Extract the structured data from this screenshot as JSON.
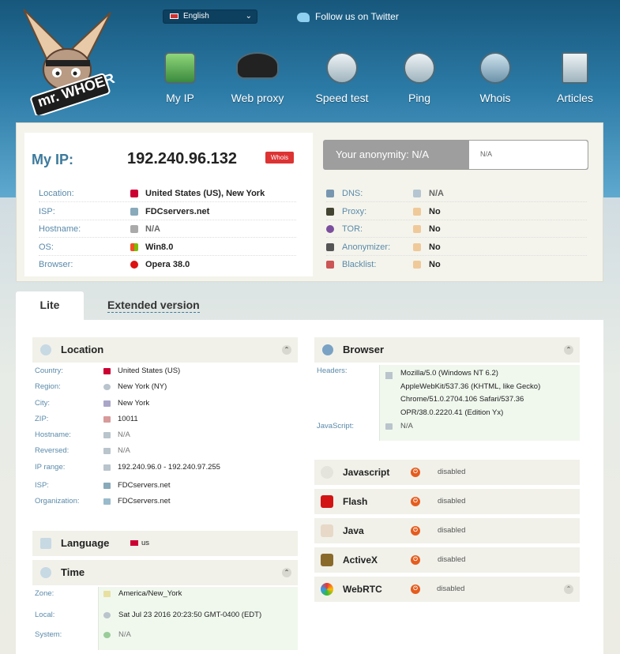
{
  "brand": {
    "logo_text": "mr. WHOER"
  },
  "header": {
    "language": "English",
    "twitter": "Follow us on Twitter",
    "nav": [
      {
        "label": "My IP",
        "icon": "home-icon"
      },
      {
        "label": "Web proxy",
        "icon": "spy-hat-icon"
      },
      {
        "label": "Speed test",
        "icon": "speedometer-icon"
      },
      {
        "label": "Ping",
        "icon": "ping-icon"
      },
      {
        "label": "Whois",
        "icon": "question-icon"
      },
      {
        "label": "Articles",
        "icon": "document-icon"
      }
    ]
  },
  "ip": {
    "label": "My IP:",
    "value": "192.240.96.132",
    "whois": "Whois",
    "rows": [
      {
        "key": "Location:",
        "value": "United States (US), New York",
        "icon": "us-flag-icon"
      },
      {
        "key": "ISP:",
        "value": "FDCservers.net",
        "icon": "isp-icon"
      },
      {
        "key": "Hostname:",
        "value": "N/A",
        "icon": "hostname-icon"
      },
      {
        "key": "OS:",
        "value": "Win8.0",
        "icon": "windows-icon"
      },
      {
        "key": "Browser:",
        "value": "Opera 38.0",
        "icon": "opera-icon"
      }
    ]
  },
  "anonymity": {
    "label": "Your anonymity: N/A",
    "value": "N/A",
    "rows": [
      {
        "key": "DNS:",
        "value": "N/A",
        "icon": "dns-icon"
      },
      {
        "key": "Proxy:",
        "value": "No",
        "icon": "thumbs-up-icon"
      },
      {
        "key": "TOR:",
        "value": "No",
        "icon": "thumbs-up-icon"
      },
      {
        "key": "Anonymizer:",
        "value": "No",
        "icon": "thumbs-up-icon"
      },
      {
        "key": "Blacklist:",
        "value": "No",
        "icon": "thumbs-up-icon"
      }
    ]
  },
  "tabs": {
    "lite": "Lite",
    "extended": "Extended version"
  },
  "location": {
    "title": "Location",
    "rows": [
      {
        "key": "Country:",
        "value": "United States (US)"
      },
      {
        "key": "Region:",
        "value": "New York (NY)"
      },
      {
        "key": "City:",
        "value": "New York"
      },
      {
        "key": "ZIP:",
        "value": "10011"
      },
      {
        "key": "Hostname:",
        "value": "N/A"
      },
      {
        "key": "Reversed:",
        "value": "N/A"
      },
      {
        "key": "IP range:",
        "value": "192.240.96.0 - 192.240.97.255"
      },
      {
        "key": "ISP:",
        "value": "FDCservers.net"
      },
      {
        "key": "Organization:",
        "value": "FDCservers.net"
      }
    ]
  },
  "language": {
    "title": "Language",
    "value": "us"
  },
  "time": {
    "title": "Time",
    "rows": [
      {
        "key": "Zone:",
        "value": "America/New_York"
      },
      {
        "key": "Local:",
        "value": "Sat Jul 23 2016 20:23:50 GMT-0400 (EDT)"
      },
      {
        "key": "System:",
        "value": "N/A"
      }
    ]
  },
  "browser": {
    "title": "Browser",
    "headers_key": "Headers:",
    "headers_lines": [
      "Mozilla/5.0 (Windows NT 6.2)",
      "AppleWebKit/537.36 (KHTML, like Gecko)",
      "Chrome/51.0.2704.106 Safari/537.36",
      "OPR/38.0.2220.41 (Edition Yx)"
    ],
    "js_key": "JavaScript:",
    "js_value": "N/A"
  },
  "plugins": [
    {
      "name": "Javascript",
      "status": "disabled",
      "icon": "javascript-icon"
    },
    {
      "name": "Flash",
      "status": "disabled",
      "icon": "flash-icon"
    },
    {
      "name": "Java",
      "status": "disabled",
      "icon": "java-icon"
    },
    {
      "name": "ActiveX",
      "status": "disabled",
      "icon": "activex-icon"
    },
    {
      "name": "WebRTC",
      "status": "disabled",
      "icon": "webrtc-icon"
    }
  ]
}
